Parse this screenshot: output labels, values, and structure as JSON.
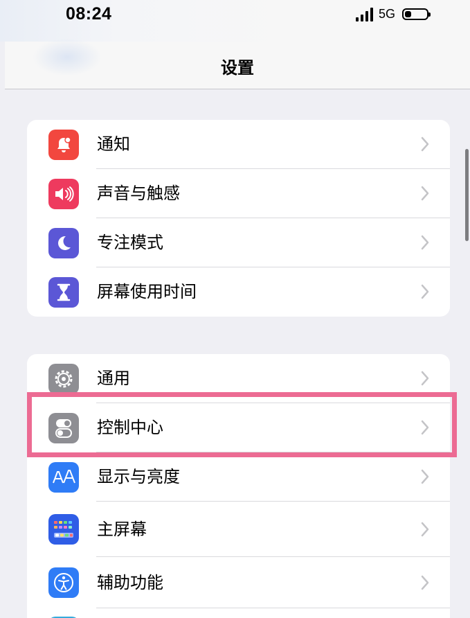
{
  "status_bar": {
    "time": "08:24",
    "network": "5G",
    "battery_icon": "battery-icon",
    "signal_icon": "signal-icon"
  },
  "nav": {
    "title": "设置"
  },
  "groups": [
    {
      "items": [
        {
          "label": "通知",
          "icon": "bell-icon",
          "color": "#f2473f"
        },
        {
          "label": "声音与触感",
          "icon": "speaker-icon",
          "color": "#ee3a5e"
        },
        {
          "label": "专注模式",
          "icon": "moon-icon",
          "color": "#5b57d6"
        },
        {
          "label": "屏幕使用时间",
          "icon": "hourglass-icon",
          "color": "#5b57d6"
        }
      ]
    },
    {
      "items": [
        {
          "label": "通用",
          "icon": "gear-icon",
          "color": "#8e8e93"
        },
        {
          "label": "控制中心",
          "icon": "toggles-icon",
          "color": "#8e8e93"
        },
        {
          "label": "显示与亮度",
          "icon": "text-size-icon",
          "color": "#2f7cf6"
        },
        {
          "label": "主屏幕",
          "icon": "home-grid-icon",
          "color": "#2f5de6"
        },
        {
          "label": "辅助功能",
          "icon": "accessibility-icon",
          "color": "#2f7cf6"
        }
      ]
    }
  ],
  "highlighted_item": "控制中心",
  "colors": {
    "highlight": "#ec6b93",
    "background": "#efeff4"
  }
}
